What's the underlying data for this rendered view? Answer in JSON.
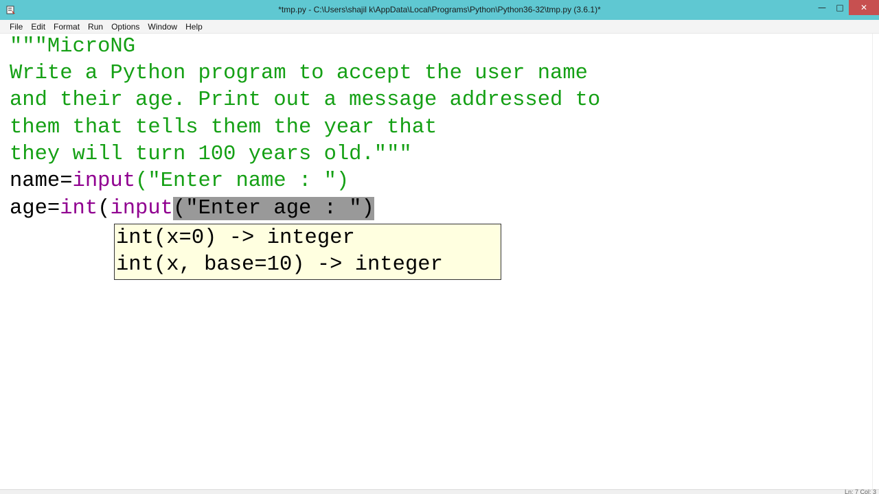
{
  "window": {
    "title": "*tmp.py - C:\\Users\\shajil k\\AppData\\Local\\Programs\\Python\\Python36-32\\tmp.py (3.6.1)*",
    "minimize_label": "—",
    "maximize_label": "□",
    "close_label": "✕"
  },
  "menu": {
    "items": [
      "File",
      "Edit",
      "Format",
      "Run",
      "Options",
      "Window",
      "Help"
    ]
  },
  "editor": {
    "lines": [
      "\"\"\"MicroNG",
      "Write a Python program to accept the user name",
      "and their age. Print out a message addressed to",
      "them that tells them the year that",
      "they will turn 100 years old.\"\"\""
    ],
    "line6": {
      "var": "name=",
      "builtin": "input",
      "arg": "(\"Enter name : \")"
    },
    "line7": {
      "var": "age=",
      "builtin1": "int",
      "paren": "(",
      "builtin2": "input",
      "selected": "(\"Enter age : \")"
    }
  },
  "calltip": {
    "lines": [
      "int(x=0) -> integer",
      "int(x, base=10) -> integer"
    ]
  },
  "status": {
    "text": "Ln: 7 Col: 3"
  },
  "colors": {
    "titlebar": "#5fc8d2",
    "string": "#15a015",
    "builtin": "#900090",
    "selection": "#999999",
    "calltip_bg": "#ffffe0"
  }
}
